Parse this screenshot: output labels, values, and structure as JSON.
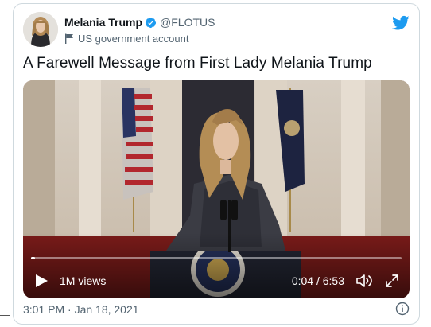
{
  "author": {
    "display_name": "Melania Trump",
    "handle": "@FLOTUS",
    "account_label": "US government account",
    "avatar_icon": "profile-photo",
    "verified_icon": "verified-badge-icon"
  },
  "brand": {
    "icon": "twitter-bird-icon",
    "color": "#1d9bf0"
  },
  "tweet": {
    "text": "A Farewell Message from First Lady Melania Trump"
  },
  "video": {
    "views": "1M views",
    "time": "0:04 / 6:53",
    "progress": 0.0097,
    "play_icon": "play-icon",
    "volume_icon": "volume-icon",
    "fullscreen_icon": "fullscreen-icon"
  },
  "footer": {
    "timestamp": "3:01 PM · Jan 18, 2021",
    "info_icon": "info-icon"
  },
  "colors": {
    "text": "#0f1419",
    "secondary": "#536471",
    "border": "#cfd9de",
    "verified": "#1d9bf0"
  }
}
